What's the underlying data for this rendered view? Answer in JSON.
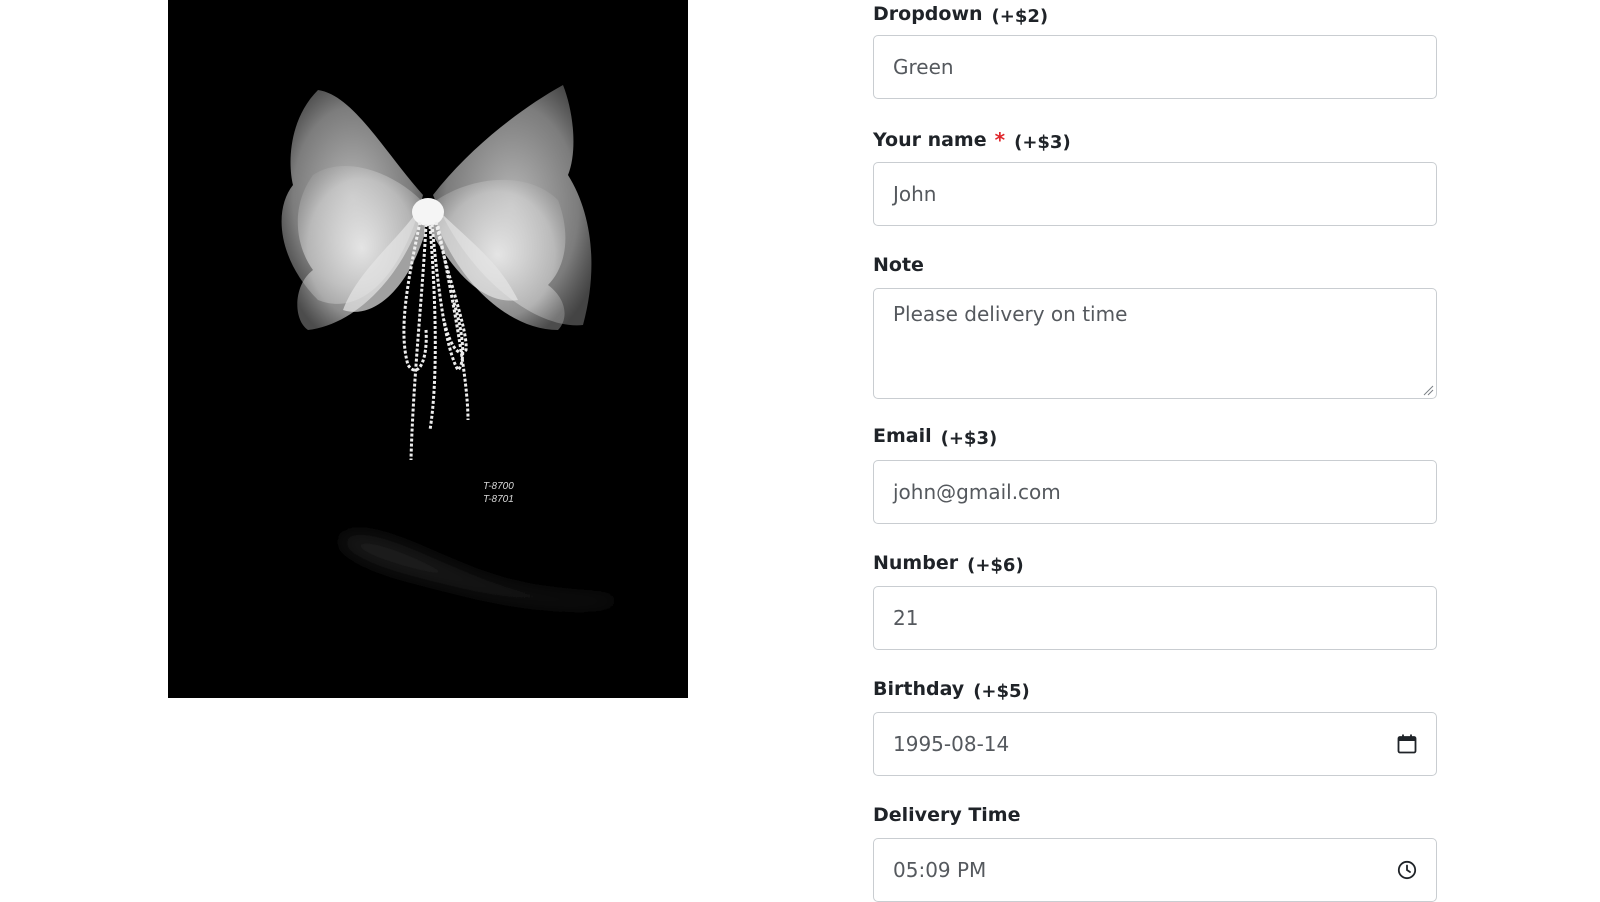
{
  "product": {
    "sku_lines": [
      "T-8700",
      "T-8701"
    ]
  },
  "form": {
    "dropdown": {
      "label": "Dropdown",
      "price": "(+$2)",
      "value": "Green"
    },
    "name": {
      "label": "Your name",
      "required_mark": "*",
      "price": "(+$3)",
      "placeholder": "John"
    },
    "note": {
      "label": "Note",
      "placeholder": "Please delivery on time"
    },
    "email": {
      "label": "Email",
      "price": "(+$3)",
      "placeholder": "john@gmail.com"
    },
    "number": {
      "label": "Number",
      "price": "(+$6)",
      "placeholder": "21"
    },
    "birthday": {
      "label": "Birthday",
      "price": "(+$5)",
      "value": "1995-08-14",
      "icon": "calendar-icon"
    },
    "delivery_time": {
      "label": "Delivery Time",
      "value": "05:09 PM",
      "icon": "clock-icon"
    }
  },
  "colors": {
    "image_background": "#000000",
    "required": "#e0262b",
    "border": "#c9cdd1"
  }
}
